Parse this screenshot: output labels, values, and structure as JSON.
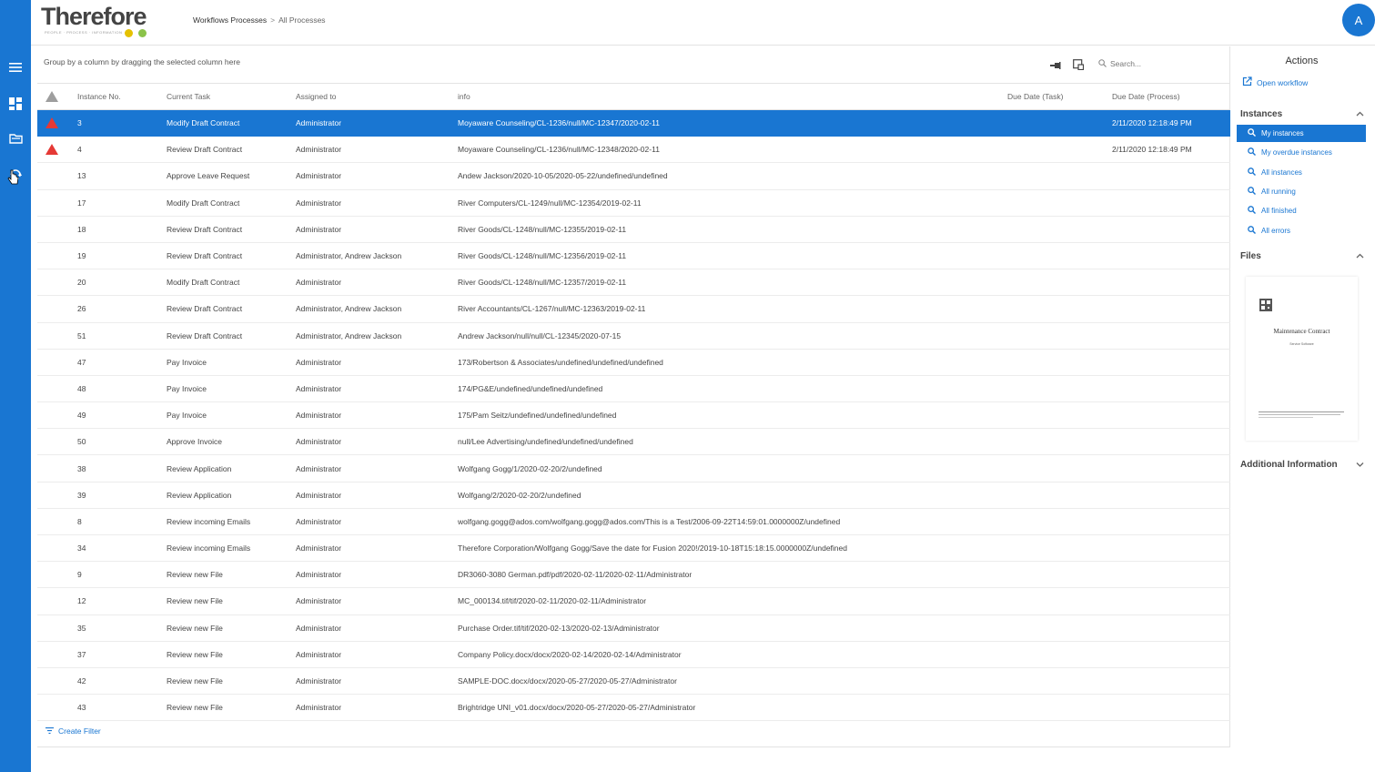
{
  "app": {
    "logo_text": "Therefore",
    "logo_tagline": "PEOPLE · PROCESS · INFORMATION",
    "avatar_initial": "A",
    "brand_color": "#1976d2"
  },
  "nav": {
    "items": [
      {
        "icon": "menu-icon"
      },
      {
        "icon": "dashboard-icon"
      },
      {
        "icon": "folder-icon"
      },
      {
        "icon": "workflow-icon"
      }
    ]
  },
  "breadcrumb": {
    "link": "Workflows Processes",
    "separator": ">",
    "current": "All Processes"
  },
  "toolbar": {
    "group_hint": "Group by a column by dragging the selected column here",
    "search_placeholder": "Search..."
  },
  "grid": {
    "columns": {
      "instance_no": "Instance No.",
      "current_task": "Current Task",
      "assigned_to": "Assigned to",
      "info": "info",
      "due_task": "Due Date (Task)",
      "due_process": "Due Date (Process)"
    },
    "rows": [
      {
        "flag": true,
        "id": "3",
        "task": "Modify Draft Contract",
        "assigned": "Administrator",
        "info": "Moyaware Counseling/CL-1236/null/MC-12347/2020-02-11",
        "due_task": "",
        "due_process": "2/11/2020 12:18:49 PM",
        "selected": true
      },
      {
        "flag": true,
        "id": "4",
        "task": "Review Draft Contract",
        "assigned": "Administrator",
        "info": "Moyaware Counseling/CL-1236/null/MC-12348/2020-02-11",
        "due_task": "",
        "due_process": "2/11/2020 12:18:49 PM"
      },
      {
        "flag": false,
        "id": "13",
        "task": "Approve Leave Request",
        "assigned": "Administrator",
        "info": "Andew Jackson/2020-10-05/2020-05-22/undefined/undefined",
        "due_task": "",
        "due_process": ""
      },
      {
        "flag": false,
        "id": "17",
        "task": "Modify Draft Contract",
        "assigned": "Administrator",
        "info": "River Computers/CL-1249/null/MC-12354/2019-02-11",
        "due_task": "",
        "due_process": ""
      },
      {
        "flag": false,
        "id": "18",
        "task": "Review Draft Contract",
        "assigned": "Administrator",
        "info": "River Goods/CL-1248/null/MC-12355/2019-02-11",
        "due_task": "",
        "due_process": ""
      },
      {
        "flag": false,
        "id": "19",
        "task": "Review Draft Contract",
        "assigned": "Administrator, Andrew Jackson",
        "info": "River Goods/CL-1248/null/MC-12356/2019-02-11",
        "due_task": "",
        "due_process": ""
      },
      {
        "flag": false,
        "id": "20",
        "task": "Modify Draft Contract",
        "assigned": "Administrator",
        "info": "River Goods/CL-1248/null/MC-12357/2019-02-11",
        "due_task": "",
        "due_process": ""
      },
      {
        "flag": false,
        "id": "26",
        "task": "Review Draft Contract",
        "assigned": "Administrator, Andrew Jackson",
        "info": "River Accountants/CL-1267/null/MC-12363/2019-02-11",
        "due_task": "",
        "due_process": ""
      },
      {
        "flag": false,
        "id": "51",
        "task": "Review Draft Contract",
        "assigned": "Administrator, Andrew Jackson",
        "info": "Andrew Jackson/null/null/CL-12345/2020-07-15",
        "due_task": "",
        "due_process": ""
      },
      {
        "flag": false,
        "id": "47",
        "task": "Pay Invoice",
        "assigned": "Administrator",
        "info": "173/Robertson & Associates/undefined/undefined/undefined",
        "due_task": "",
        "due_process": ""
      },
      {
        "flag": false,
        "id": "48",
        "task": "Pay Invoice",
        "assigned": "Administrator",
        "info": "174/PG&E/undefined/undefined/undefined",
        "due_task": "",
        "due_process": ""
      },
      {
        "flag": false,
        "id": "49",
        "task": "Pay Invoice",
        "assigned": "Administrator",
        "info": "175/Pam Seitz/undefined/undefined/undefined",
        "due_task": "",
        "due_process": ""
      },
      {
        "flag": false,
        "id": "50",
        "task": "Approve Invoice",
        "assigned": "Administrator",
        "info": "null/Lee Advertising/undefined/undefined/undefined",
        "due_task": "",
        "due_process": ""
      },
      {
        "flag": false,
        "id": "38",
        "task": "Review Application",
        "assigned": "Administrator",
        "info": "Wolfgang Gogg/1/2020-02-20/2/undefined",
        "due_task": "",
        "due_process": ""
      },
      {
        "flag": false,
        "id": "39",
        "task": "Review Application",
        "assigned": "Administrator",
        "info": "Wolfgang/2/2020-02-20/2/undefined",
        "due_task": "",
        "due_process": ""
      },
      {
        "flag": false,
        "id": "8",
        "task": "Review incoming Emails",
        "assigned": "Administrator",
        "info": "wolfgang.gogg@ados.com/wolfgang.gogg@ados.com/This is a Test/2006-09-22T14:59:01.0000000Z/undefined",
        "due_task": "",
        "due_process": ""
      },
      {
        "flag": false,
        "id": "34",
        "task": "Review incoming Emails",
        "assigned": "Administrator",
        "info": "Therefore Corporation/Wolfgang Gogg/Save the date for Fusion 2020!/2019-10-18T15:18:15.0000000Z/undefined",
        "due_task": "",
        "due_process": ""
      },
      {
        "flag": false,
        "id": "9",
        "task": "Review new File",
        "assigned": "Administrator",
        "info": "DR3060-3080 German.pdf/pdf/2020-02-11/2020-02-11/Administrator",
        "due_task": "",
        "due_process": ""
      },
      {
        "flag": false,
        "id": "12",
        "task": "Review new File",
        "assigned": "Administrator",
        "info": "MC_000134.tif/tif/2020-02-11/2020-02-11/Administrator",
        "due_task": "",
        "due_process": ""
      },
      {
        "flag": false,
        "id": "35",
        "task": "Review new File",
        "assigned": "Administrator",
        "info": "Purchase Order.tif/tif/2020-02-13/2020-02-13/Administrator",
        "due_task": "",
        "due_process": ""
      },
      {
        "flag": false,
        "id": "37",
        "task": "Review new File",
        "assigned": "Administrator",
        "info": "Company Policy.docx/docx/2020-02-14/2020-02-14/Administrator",
        "due_task": "",
        "due_process": ""
      },
      {
        "flag": false,
        "id": "42",
        "task": "Review new File",
        "assigned": "Administrator",
        "info": "SAMPLE-DOC.docx/docx/2020-05-27/2020-05-27/Administrator",
        "due_task": "",
        "due_process": ""
      },
      {
        "flag": false,
        "id": "43",
        "task": "Review new File",
        "assigned": "Administrator",
        "info": "Brightridge UNI_v01.docx/docx/2020-05-27/2020-05-27/Administrator",
        "due_task": "",
        "due_process": ""
      }
    ]
  },
  "footer": {
    "create_filter": "Create Filter"
  },
  "side": {
    "title": "Actions",
    "open_workflow": "Open workflow",
    "instances_head": "Instances",
    "instances": [
      {
        "label": "My instances",
        "active": true
      },
      {
        "label": "My overdue instances"
      },
      {
        "label": "All instances"
      },
      {
        "label": "All running"
      },
      {
        "label": "All finished"
      },
      {
        "label": "All errors"
      }
    ],
    "files_head": "Files",
    "file_title": "Maintenance Contract",
    "file_subtitle": "Service Software",
    "additional_info": "Additional Information"
  },
  "colors": {
    "flag": "#e53935",
    "accent": "#1976d2",
    "logo_dot_yellow": "#e5c100",
    "logo_dot_green": "#8bc34a"
  }
}
